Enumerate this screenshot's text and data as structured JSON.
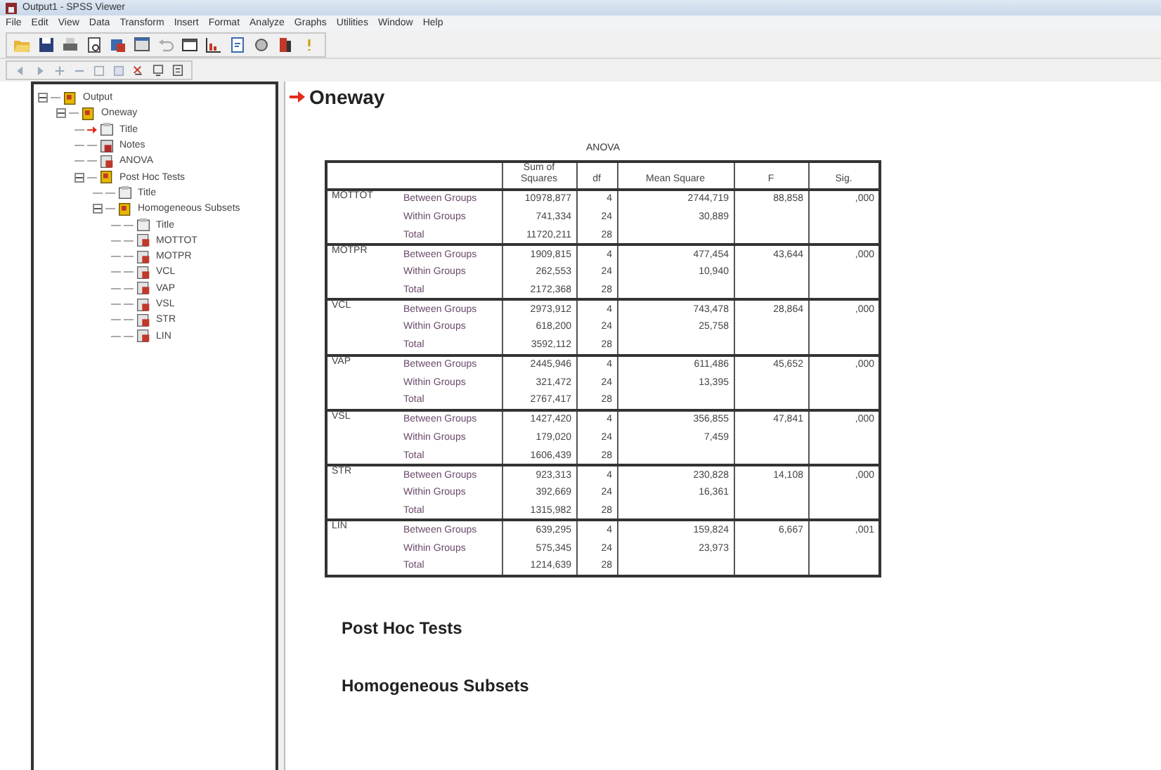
{
  "window": {
    "title": "Output1 - SPSS Viewer"
  },
  "menu": [
    "File",
    "Edit",
    "View",
    "Data",
    "Transform",
    "Insert",
    "Format",
    "Analyze",
    "Graphs",
    "Utilities",
    "Window",
    "Help"
  ],
  "tree": [
    {
      "label": "Output",
      "kind": "book",
      "expanded": true,
      "current": false,
      "children": [
        {
          "label": "Oneway",
          "kind": "book",
          "expanded": true,
          "current": false,
          "children": [
            {
              "label": "Title",
              "kind": "title",
              "current": true
            },
            {
              "label": "Notes",
              "kind": "notes",
              "current": false
            },
            {
              "label": "ANOVA",
              "kind": "table",
              "current": false
            },
            {
              "label": "Post Hoc Tests",
              "kind": "book",
              "expanded": true,
              "current": false,
              "children": [
                {
                  "label": "Title",
                  "kind": "title",
                  "current": false
                },
                {
                  "label": "Homogeneous Subsets",
                  "kind": "book",
                  "expanded": true,
                  "current": false,
                  "children": [
                    {
                      "label": "Title",
                      "kind": "title",
                      "current": false
                    },
                    {
                      "label": "MOTTOT",
                      "kind": "table",
                      "current": false
                    },
                    {
                      "label": "MOTPR",
                      "kind": "table",
                      "current": false
                    },
                    {
                      "label": "VCL",
                      "kind": "table",
                      "current": false
                    },
                    {
                      "label": "VAP",
                      "kind": "table",
                      "current": false
                    },
                    {
                      "label": "VSL",
                      "kind": "table",
                      "current": false
                    },
                    {
                      "label": "STR",
                      "kind": "table",
                      "current": false
                    },
                    {
                      "label": "LIN",
                      "kind": "table",
                      "current": false
                    }
                  ]
                }
              ]
            }
          ]
        }
      ]
    }
  ],
  "output": {
    "heading": "Oneway",
    "table": {
      "title": "ANOVA",
      "columns": [
        "",
        "",
        "Sum of Squares",
        "df",
        "Mean Square",
        "F",
        "Sig."
      ],
      "blocks": [
        {
          "variable": "MOTTOT",
          "rows": [
            [
              "Between Groups",
              "10978,877",
              "4",
              "2744,719",
              "88,858",
              ",000"
            ],
            [
              "Within Groups",
              "741,334",
              "24",
              "30,889",
              "",
              ""
            ],
            [
              "Total",
              "11720,211",
              "28",
              "",
              "",
              ""
            ]
          ]
        },
        {
          "variable": "MOTPR",
          "rows": [
            [
              "Between Groups",
              "1909,815",
              "4",
              "477,454",
              "43,644",
              ",000"
            ],
            [
              "Within Groups",
              "262,553",
              "24",
              "10,940",
              "",
              ""
            ],
            [
              "Total",
              "2172,368",
              "28",
              "",
              "",
              ""
            ]
          ]
        },
        {
          "variable": "VCL",
          "rows": [
            [
              "Between Groups",
              "2973,912",
              "4",
              "743,478",
              "28,864",
              ",000"
            ],
            [
              "Within Groups",
              "618,200",
              "24",
              "25,758",
              "",
              ""
            ],
            [
              "Total",
              "3592,112",
              "28",
              "",
              "",
              ""
            ]
          ]
        },
        {
          "variable": "VAP",
          "rows": [
            [
              "Between Groups",
              "2445,946",
              "4",
              "611,486",
              "45,652",
              ",000"
            ],
            [
              "Within Groups",
              "321,472",
              "24",
              "13,395",
              "",
              ""
            ],
            [
              "Total",
              "2767,417",
              "28",
              "",
              "",
              ""
            ]
          ]
        },
        {
          "variable": "VSL",
          "rows": [
            [
              "Between Groups",
              "1427,420",
              "4",
              "356,855",
              "47,841",
              ",000"
            ],
            [
              "Within Groups",
              "179,020",
              "24",
              "7,459",
              "",
              ""
            ],
            [
              "Total",
              "1606,439",
              "28",
              "",
              "",
              ""
            ]
          ]
        },
        {
          "variable": "STR",
          "rows": [
            [
              "Between Groups",
              "923,313",
              "4",
              "230,828",
              "14,108",
              ",000"
            ],
            [
              "Within Groups",
              "392,669",
              "24",
              "16,361",
              "",
              ""
            ],
            [
              "Total",
              "1315,982",
              "28",
              "",
              "",
              ""
            ]
          ]
        },
        {
          "variable": "LIN",
          "rows": [
            [
              "Between Groups",
              "639,295",
              "4",
              "159,824",
              "6,667",
              ",001"
            ],
            [
              "Within Groups",
              "575,345",
              "24",
              "23,973",
              "",
              ""
            ],
            [
              "Total",
              "1214,639",
              "28",
              "",
              "",
              ""
            ]
          ]
        }
      ]
    },
    "sections": [
      "Post Hoc Tests",
      "Homogeneous Subsets"
    ]
  }
}
